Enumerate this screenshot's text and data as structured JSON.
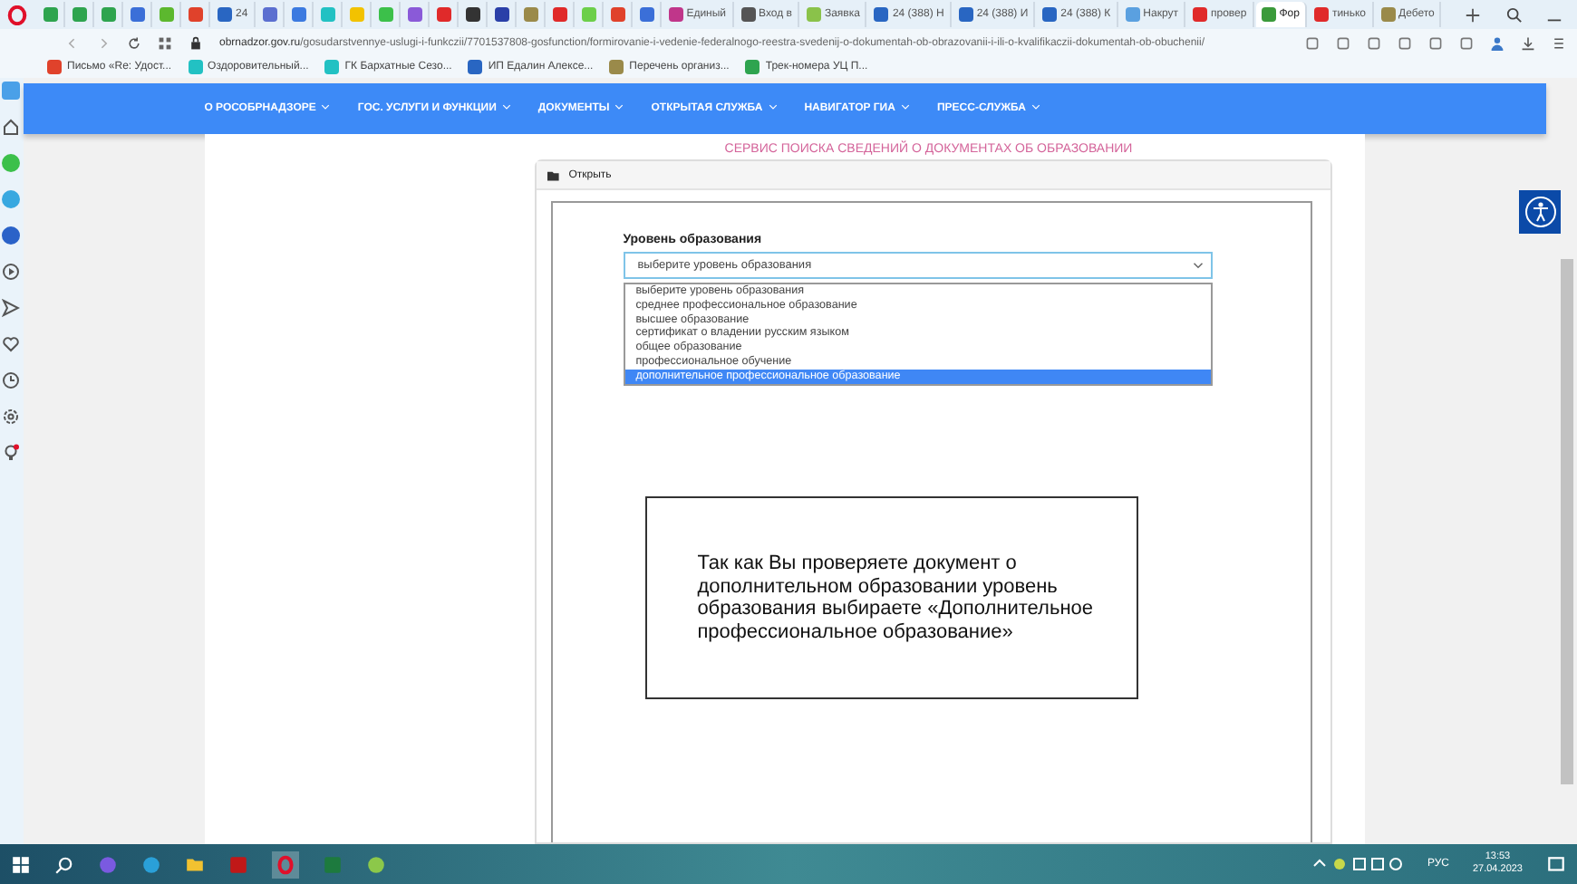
{
  "browser": {
    "tabs": [
      {
        "color": "#2ea44f",
        "selected": false
      },
      {
        "color": "#2ea44f",
        "selected": false
      },
      {
        "color": "#2ea44f",
        "selected": false
      },
      {
        "color": "#3b6fd8",
        "selected": false
      },
      {
        "color": "#5cb82e",
        "selected": false
      },
      {
        "color": "#e0422b",
        "selected": false
      },
      {
        "label": "24",
        "color": "#2966c2",
        "selected": false
      },
      {
        "color": "#5b6fd0",
        "selected": false
      },
      {
        "color": "#3b7ae0",
        "selected": false
      },
      {
        "color": "#22c1c3",
        "selected": false
      },
      {
        "color": "#f2c200",
        "selected": false
      },
      {
        "color": "#3cc04a",
        "selected": false
      },
      {
        "color": "#8a5ad8",
        "selected": false
      },
      {
        "color": "#e02a2a",
        "selected": false
      },
      {
        "color": "#333333",
        "selected": false
      },
      {
        "color": "#2a3fa8",
        "selected": false
      },
      {
        "color": "#9a8a4a",
        "selected": false
      },
      {
        "color": "#e02a2a",
        "selected": false
      },
      {
        "color": "#6ccf4a",
        "selected": false
      },
      {
        "color": "#e0422b",
        "selected": false
      },
      {
        "color": "#3b6fd8",
        "selected": false
      },
      {
        "label": "Единый",
        "color": "#c0368a",
        "selected": false
      },
      {
        "label": "Вход в",
        "color": "#555555",
        "selected": false
      },
      {
        "label": "Заявка",
        "color": "#8ac24a",
        "selected": false
      },
      {
        "label": "24 (388) Н",
        "color": "#2966c2",
        "selected": false
      },
      {
        "label": "24 (388) И",
        "color": "#2966c2",
        "selected": false
      },
      {
        "label": "24 (388) К",
        "color": "#2966c2",
        "selected": false
      },
      {
        "label": "Накрут",
        "color": "#5aa0e0",
        "selected": false
      },
      {
        "label": "провер",
        "color": "#e02a2a",
        "selected": false
      },
      {
        "label": "Фор",
        "color": "#3a9a3a",
        "selected": true
      },
      {
        "label": "тинько",
        "color": "#e02a2a",
        "selected": false
      },
      {
        "label": "Дебето",
        "color": "#9a8a4a",
        "selected": false
      }
    ],
    "url_host": "obrnadzor.gov.ru",
    "url_path": "/gosudarstvennye-uslugi-i-funkczii/7701537808-gosfunction/formirovanie-i-vedenie-federalnogo-reestra-svedenij-o-dokumentah-ob-obrazovanii-i-ili-o-kvalifikaczii-dokumentah-ob-obuchenii/",
    "bookmarks": [
      {
        "label": "Письмо «Re: Удост...",
        "color": "#e0422b"
      },
      {
        "label": "Оздоровительный...",
        "color": "#22c1c3"
      },
      {
        "label": "ГК Бархатные Сезо...",
        "color": "#22c1c3"
      },
      {
        "label": "ИП Едалин Алексе...",
        "color": "#2966c2"
      },
      {
        "label": "Перечень организ...",
        "color": "#9a8a4a"
      },
      {
        "label": "Трек-номера УЦ П...",
        "color": "#2ea44f"
      }
    ]
  },
  "site": {
    "nav": [
      "О РОСОБРНАДЗОРЕ",
      "ГОС. УСЛУГИ И ФУНКЦИИ",
      "ДОКУМЕНТЫ",
      "ОТКРЫТАЯ СЛУЖБА",
      "НАВИГАТОР ГИА",
      "ПРЕСС-СЛУЖБА"
    ],
    "heading": "СЕРВИС ПОИСКА СВЕДЕНИЙ О ДОКУМЕНТАХ ОБ ОБРАЗОВАНИИ",
    "panel_title": "Открыть",
    "field_label": "Уровень образования",
    "select_value": "выберите уровень образования",
    "options": [
      {
        "label": "выберите уровень образования",
        "selected": false
      },
      {
        "label": "среднее профессиональное образование",
        "selected": false
      },
      {
        "label": "высшее образование",
        "selected": false
      },
      {
        "label": "сертификат о владении русским языком",
        "selected": false
      },
      {
        "label": "общее образование",
        "selected": false
      },
      {
        "label": "профессиональное обучение",
        "selected": false
      },
      {
        "label": "дополнительное профессиональное образование",
        "selected": true
      }
    ],
    "note": "Так как Вы проверяете документ о дополнительном образовании уровень образования выбираете «Дополнительное профессиональное образование»"
  },
  "taskbar": {
    "language": "РУС",
    "time": "13:53",
    "date": "27.04.2023"
  }
}
